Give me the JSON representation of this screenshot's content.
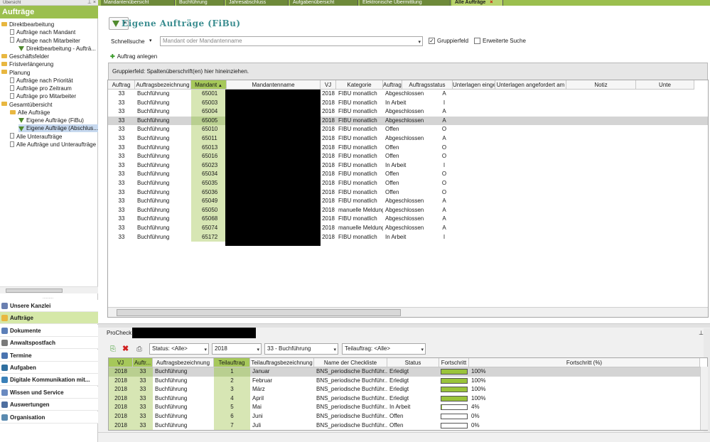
{
  "left_panel": {
    "header": "Übersicht",
    "title": "Aufträge",
    "tree": [
      {
        "label": "Direktbearbeitung",
        "icon": "folder-icon"
      },
      {
        "label": "Aufträge nach Mandant",
        "icon": "document-icon"
      },
      {
        "label": "Aufträge nach Mitarbeiter",
        "icon": "document-icon"
      },
      {
        "label": "Direktbearbeitung - Aufträ...",
        "icon": "filter-icon"
      },
      {
        "label": "Geschäftsfelder",
        "icon": "folder-icon"
      },
      {
        "label": "Fristverlängerung",
        "icon": "folder-icon"
      },
      {
        "label": "Planung",
        "icon": "folder-icon"
      },
      {
        "label": "Aufträge nach Priorität",
        "icon": "document-icon"
      },
      {
        "label": "Aufträge pro Zeitraum",
        "icon": "document-icon"
      },
      {
        "label": "Aufträge pro Mitarbeiter",
        "icon": "document-icon"
      },
      {
        "label": "Gesamtübersicht",
        "icon": "folder-icon"
      },
      {
        "label": "Alle Aufträge",
        "icon": "folder-icon"
      },
      {
        "label": "Eigene Aufträge (FiBu)",
        "icon": "filter-icon"
      },
      {
        "label": "Eigene Aufträge (Abschlus...",
        "icon": "filter-icon"
      },
      {
        "label": "Alle Unteraufträge",
        "icon": "document-icon"
      },
      {
        "label": "Alle Aufträge und Unteraufträge",
        "icon": "document-icon"
      }
    ],
    "nav_buttons": [
      {
        "label": "Unsere Kanzlei",
        "color": "#6a7fb0"
      },
      {
        "label": "Aufträge",
        "color": "#e8b740"
      },
      {
        "label": "Dokumente",
        "color": "#5c7fb8"
      },
      {
        "label": "Anwaltspostfach",
        "color": "#7a7a7a"
      },
      {
        "label": "Termine",
        "color": "#4a74b0"
      },
      {
        "label": "Aufgaben",
        "color": "#2f6f9f"
      },
      {
        "label": "Digitale Kommunikation mit...",
        "color": "#3a80b8"
      },
      {
        "label": "Wissen und Service",
        "color": "#6a8ac0"
      },
      {
        "label": "Auswertungen",
        "color": "#4f6fa0"
      },
      {
        "label": "Organisation",
        "color": "#5a8ab0"
      }
    ]
  },
  "tabs": [
    {
      "label": "Mandantenübersicht"
    },
    {
      "label": "Buchführung"
    },
    {
      "label": "Jahresabschluss"
    },
    {
      "label": "Aufgabenübersicht"
    },
    {
      "label": "Elektronische Übermittlung"
    },
    {
      "label": "Alle Aufträge",
      "close": "×"
    }
  ],
  "main": {
    "title": "Eigene Aufträge (FiBu)",
    "quicksearch_label": "Schnellsuche",
    "search_placeholder": "Mandant oder Mandantenname",
    "groupfield_label": "Gruppierfeld",
    "extended_search_label": "Erweiterte Suche",
    "add_order_label": "Auftrag anlegen",
    "group_panel_text": "Gruppierfeld: Spaltenüberschrift(en) hier hineinziehen.",
    "columns": [
      "Auftrag",
      "Auftragsbezeichnung",
      "Mandant",
      "Mandantenname",
      "VJ",
      "Kategorie",
      "Auftragsstatus_Bez",
      "Auftragsstatus",
      "Unterlagen eingegangen am",
      "Unterlagen angefordert am",
      "Notiz",
      "Unte"
    ],
    "rows": [
      {
        "auftrag": "33",
        "bez": "Buchführung",
        "mandant": "65001",
        "vj": "2018",
        "kategorie": "FIBU monatlich",
        "status_bez": "Abgeschlossen",
        "status": "A"
      },
      {
        "auftrag": "33",
        "bez": "Buchführung",
        "mandant": "65003",
        "vj": "2018",
        "kategorie": "FIBU monatlich",
        "status_bez": "In Arbeit",
        "status": "I"
      },
      {
        "auftrag": "33",
        "bez": "Buchführung",
        "mandant": "65004",
        "vj": "2018",
        "kategorie": "FIBU monatlich",
        "status_bez": "Abgeschlossen",
        "status": "A"
      },
      {
        "auftrag": "33",
        "bez": "Buchführung",
        "mandant": "65005",
        "vj": "2018",
        "kategorie": "FIBU monatlich",
        "status_bez": "Abgeschlossen",
        "status": "A"
      },
      {
        "auftrag": "33",
        "bez": "Buchführung",
        "mandant": "65010",
        "vj": "2018",
        "kategorie": "FIBU monatlich",
        "status_bez": "Offen",
        "status": "O"
      },
      {
        "auftrag": "33",
        "bez": "Buchführung",
        "mandant": "65011",
        "vj": "2018",
        "kategorie": "FIBU monatlich",
        "status_bez": "Abgeschlossen",
        "status": "A"
      },
      {
        "auftrag": "33",
        "bez": "Buchführung",
        "mandant": "65013",
        "vj": "2018",
        "kategorie": "FIBU monatlich",
        "status_bez": "Offen",
        "status": "O"
      },
      {
        "auftrag": "33",
        "bez": "Buchführung",
        "mandant": "65016",
        "vj": "2018",
        "kategorie": "FIBU monatlich",
        "status_bez": "Offen",
        "status": "O"
      },
      {
        "auftrag": "33",
        "bez": "Buchführung",
        "mandant": "65023",
        "vj": "2018",
        "kategorie": "FIBU monatlich",
        "status_bez": "In Arbeit",
        "status": "I"
      },
      {
        "auftrag": "33",
        "bez": "Buchführung",
        "mandant": "65034",
        "vj": "2018",
        "kategorie": "FIBU monatlich",
        "status_bez": "Offen",
        "status": "O"
      },
      {
        "auftrag": "33",
        "bez": "Buchführung",
        "mandant": "65035",
        "vj": "2018",
        "kategorie": "FIBU monatlich",
        "status_bez": "Offen",
        "status": "O"
      },
      {
        "auftrag": "33",
        "bez": "Buchführung",
        "mandant": "65036",
        "vj": "2018",
        "kategorie": "FIBU monatlich",
        "status_bez": "Offen",
        "status": "O"
      },
      {
        "auftrag": "33",
        "bez": "Buchführung",
        "mandant": "65049",
        "vj": "2018",
        "kategorie": "FIBU monatlich",
        "status_bez": "Abgeschlossen",
        "status": "A"
      },
      {
        "auftrag": "33",
        "bez": "Buchführung",
        "mandant": "65050",
        "vj": "2018",
        "kategorie": "manuelle Meldungen",
        "status_bez": "Abgeschlossen",
        "status": "A"
      },
      {
        "auftrag": "33",
        "bez": "Buchführung",
        "mandant": "65068",
        "vj": "2018",
        "kategorie": "FIBU monatlich",
        "status_bez": "Abgeschlossen",
        "status": "A"
      },
      {
        "auftrag": "33",
        "bez": "Buchführung",
        "mandant": "65074",
        "vj": "2018",
        "kategorie": "manuelle Meldungen",
        "status_bez": "Abgeschlossen",
        "status": "A"
      },
      {
        "auftrag": "33",
        "bez": "Buchführung",
        "mandant": "65172",
        "vj": "2018",
        "kategorie": "FIBU monatlich",
        "status_bez": "In Arbeit",
        "status": "I"
      }
    ]
  },
  "procheck": {
    "label": "ProCheck -",
    "status_select": "Status: <Alle>",
    "year_select": "2018",
    "order_select": "33 - Buchführung",
    "suborder_select": "Teilauftrag: <Alle>",
    "columns": [
      "VJ",
      "Auftr...",
      "Auftragsbezeichnung",
      "Teilauftrag",
      "Teilauftragsbezeichnung",
      "Name der Checkliste",
      "Status",
      "Fortschritt",
      "Fortschritt (%)"
    ],
    "rows": [
      {
        "vj": "2018",
        "auftr": "33",
        "bez": "Buchführung",
        "teil": "1",
        "teilbez": "Januar",
        "checkliste": "BNS_periodische Buchführ...",
        "status": "Erledigt",
        "progress": 100,
        "progress_text": "100%"
      },
      {
        "vj": "2018",
        "auftr": "33",
        "bez": "Buchführung",
        "teil": "2",
        "teilbez": "Februar",
        "checkliste": "BNS_periodische Buchführ...",
        "status": "Erledigt",
        "progress": 100,
        "progress_text": "100%"
      },
      {
        "vj": "2018",
        "auftr": "33",
        "bez": "Buchführung",
        "teil": "3",
        "teilbez": "März",
        "checkliste": "BNS_periodische Buchführ...",
        "status": "Erledigt",
        "progress": 100,
        "progress_text": "100%"
      },
      {
        "vj": "2018",
        "auftr": "33",
        "bez": "Buchführung",
        "teil": "4",
        "teilbez": "April",
        "checkliste": "BNS_periodische Buchführ...",
        "status": "Erledigt",
        "progress": 100,
        "progress_text": "100%"
      },
      {
        "vj": "2018",
        "auftr": "33",
        "bez": "Buchführung",
        "teil": "5",
        "teilbez": "Mai",
        "checkliste": "BNS_periodische Buchführ...",
        "status": "In Arbeit",
        "progress": 4,
        "progress_text": "4%"
      },
      {
        "vj": "2018",
        "auftr": "33",
        "bez": "Buchführung",
        "teil": "6",
        "teilbez": "Juni",
        "checkliste": "BNS_periodische Buchführ...",
        "status": "Offen",
        "progress": 0,
        "progress_text": "0%"
      },
      {
        "vj": "2018",
        "auftr": "33",
        "bez": "Buchführung",
        "teil": "7",
        "teilbez": "Juli",
        "checkliste": "BNS_periodische Buchführ...",
        "status": "Offen",
        "progress": 0,
        "progress_text": "0%"
      }
    ]
  },
  "colors": {
    "accent": "#9bbf4e",
    "title": "#3b8d90",
    "progress": "#9ac43a"
  }
}
